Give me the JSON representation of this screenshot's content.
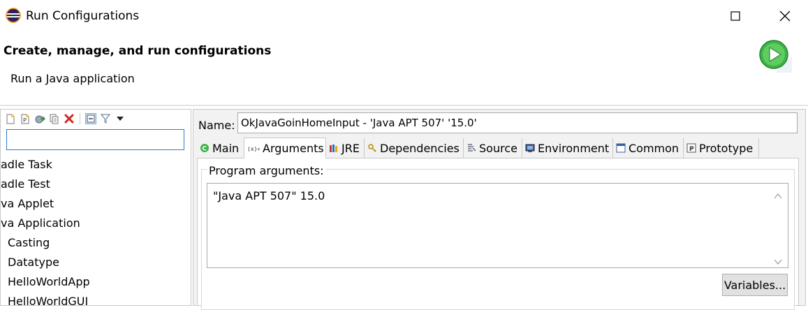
{
  "window": {
    "title": "Run Configurations"
  },
  "header": {
    "title": "Create, manage, and run configurations",
    "subtitle": "Run a Java application"
  },
  "left_panel": {
    "filter_value": "",
    "tree_items": [
      "adle Task",
      "adle Test",
      "va Applet",
      "va Application",
      "Casting",
      "Datatype",
      "HelloWorldApp",
      "HelloWorldGUI"
    ]
  },
  "config": {
    "name_label": "Name:",
    "name_value": "OkJavaGoinHomeInput - 'Java APT 507' '15.0'",
    "tabs": [
      {
        "label": "Main",
        "icon": "main-tab-icon",
        "active": false
      },
      {
        "label": "Arguments",
        "icon": "arguments-tab-icon",
        "active": true
      },
      {
        "label": "JRE",
        "icon": "jre-tab-icon",
        "active": false
      },
      {
        "label": "Dependencies",
        "icon": "dependencies-tab-icon",
        "active": false
      },
      {
        "label": "Source",
        "icon": "source-tab-icon",
        "active": false
      },
      {
        "label": "Environment",
        "icon": "environment-tab-icon",
        "active": false
      },
      {
        "label": "Common",
        "icon": "common-tab-icon",
        "active": false
      },
      {
        "label": "Prototype",
        "icon": "prototype-tab-icon",
        "active": false
      }
    ],
    "program_args_label": "Program arguments:",
    "program_args_value": "\"Java APT 507\" 15.0",
    "variables_button": "Variables..."
  },
  "colors": {
    "accent": "#2f78d1",
    "run_green": "#3cb44a",
    "delete_red": "#d42323"
  }
}
